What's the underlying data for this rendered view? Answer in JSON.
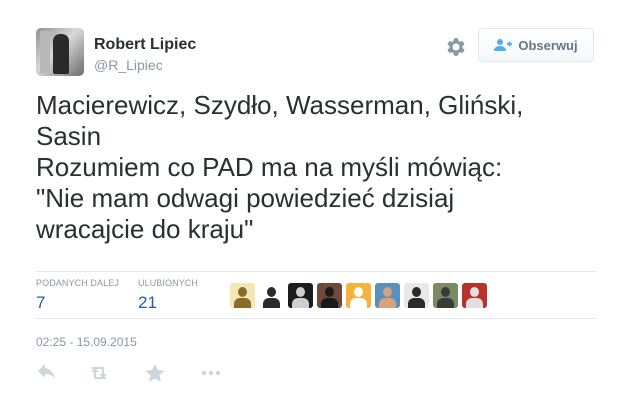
{
  "author": {
    "fullname": "Robert Lipiec",
    "username": "@R_Lipiec",
    "avatar_icon": "user-avatar-photo"
  },
  "header": {
    "settings_icon": "gear-icon",
    "follow_label": "Obserwuj",
    "follow_icon": "add-user-icon"
  },
  "tweet": {
    "text": "Macierewicz, Szydło, Wasserman, Gliński,\nSasin\nRozumiem co PAD ma na myśli mówiąc:\n\"Nie mam odwagi powiedzieć dzisiaj\nwracajcie do kraju\""
  },
  "stats": {
    "retweets_label": "PODANYCH DALEJ",
    "retweets_count": "7",
    "favorites_label": "ULUBIONYCH",
    "favorites_count": "21"
  },
  "favoriters": [
    {
      "name": "favoriter-avatar-1",
      "bg": "#f3e7b4",
      "fg": "#8a6b2a"
    },
    {
      "name": "favoriter-avatar-2",
      "bg": "#ffffff",
      "fg": "#2b2b2b"
    },
    {
      "name": "favoriter-avatar-3",
      "bg": "#1c1c1c",
      "fg": "#cfcfcf"
    },
    {
      "name": "favoriter-avatar-4",
      "bg": "#6e4a3a",
      "fg": "#1a1a1a"
    },
    {
      "name": "favoriter-avatar-5",
      "bg": "#f6b33c",
      "fg": "#ffffff"
    },
    {
      "name": "favoriter-avatar-6",
      "bg": "#5a8fc2",
      "fg": "#d9a27a"
    },
    {
      "name": "favoriter-avatar-7",
      "bg": "#e8e8e8",
      "fg": "#2a2a2a"
    },
    {
      "name": "favoriter-avatar-8",
      "bg": "#7c8a62",
      "fg": "#3a3a3a"
    },
    {
      "name": "favoriter-avatar-9",
      "bg": "#b8322c",
      "fg": "#e0e0e0"
    }
  ],
  "timestamp": "02:25 - 15.09.2015",
  "actions": {
    "reply_icon": "reply-icon",
    "retweet_icon": "retweet-icon",
    "favorite_icon": "star-icon",
    "more_icon": "more-icon"
  },
  "colors": {
    "text": "#292f33",
    "muted": "#8899a6",
    "link": "#1c5fa8",
    "border": "#e1e8ed",
    "icon": "#ccd6dd"
  }
}
